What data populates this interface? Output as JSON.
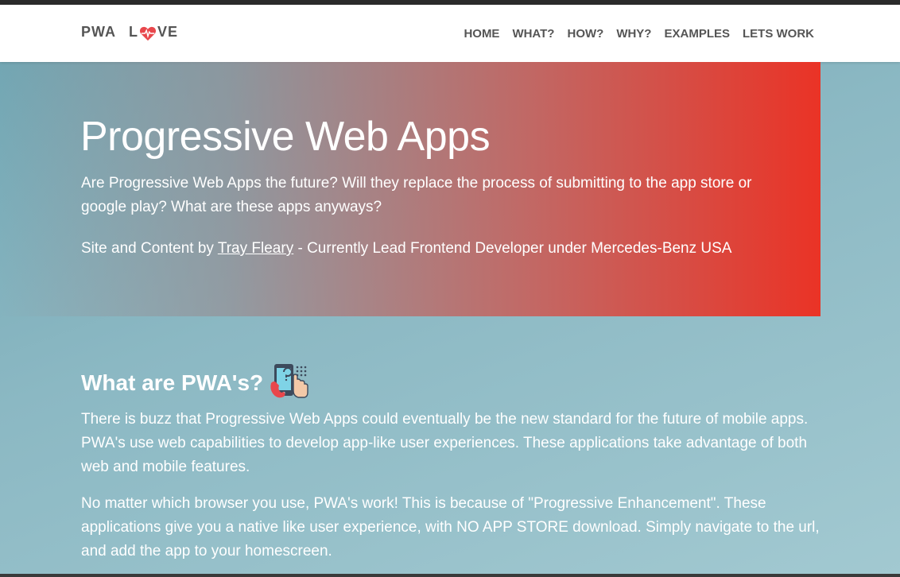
{
  "nav": {
    "brand_left": "PWA",
    "brand_l": "L",
    "brand_right": "VE",
    "links": [
      "HOME",
      "WHAT?",
      "HOW?",
      "WHY?",
      "EXAMPLES",
      "LETS WORK"
    ]
  },
  "hero": {
    "title": "Progressive Web Apps",
    "text": "Are Progressive Web Apps the future? Will they replace the process of submitting to the app store or google play? What are these apps anyways?",
    "credit_prefix": "Site and Content by ",
    "credit_link": "Tray Fleary",
    "credit_suffix": " - Currently Lead Frontend Developer under Mercedes-Benz USA"
  },
  "section": {
    "title": "What are PWA's?",
    "para1": "There is buzz that Progressive Web Apps could eventually be the new standard for the future of mobile apps. PWA's use web capabilities to develop app-like user experiences. These applications take advantage of both web and mobile features.",
    "para2": "No matter which browser you use, PWA's work! This is because of \"Progressive Enhancement\". These applications give you a native like user experience, with NO APP STORE download. Simply navigate to the url, and add the app to your homescreen."
  },
  "colors": {
    "accent_red": "#ea3326",
    "nav_text": "#555555",
    "hero_text": "#ffffff"
  },
  "icons": {
    "brand_icon": "heart-icon",
    "section_icon": "phone-touch-icon"
  }
}
